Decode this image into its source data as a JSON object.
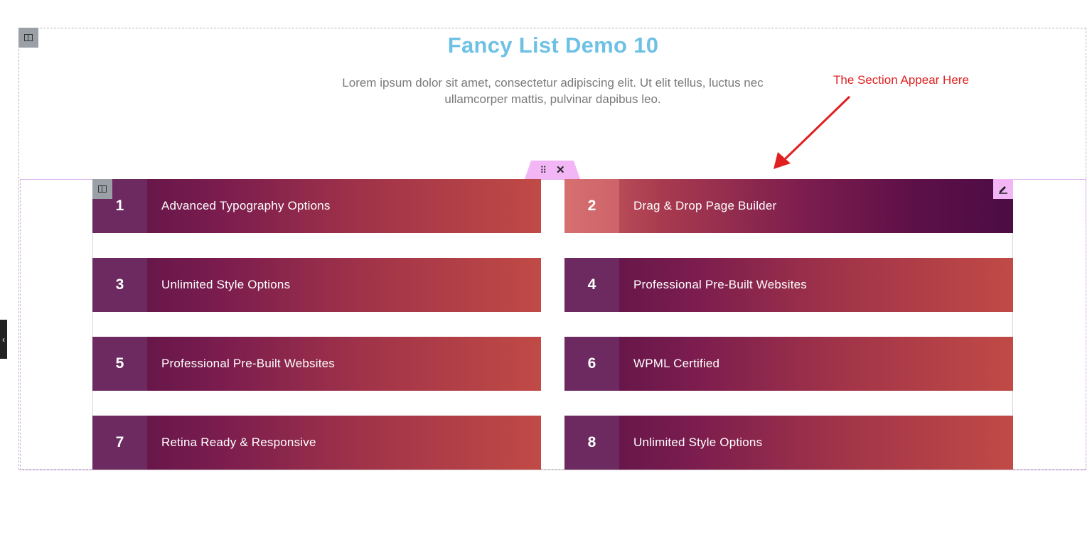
{
  "page": {
    "title": "Fancy List Demo 10",
    "description": "Lorem ipsum dolor sit amet, consectetur adipiscing elit. Ut elit tellus, luctus nec ullamcorper mattis, pulvinar dapibus leo."
  },
  "annotation": {
    "text": "The Section Appear Here",
    "color": "#e02020"
  },
  "editor": {
    "drag_icon": "⠿",
    "close_icon": "✕",
    "side_toggle": "‹"
  },
  "list": {
    "items": [
      {
        "number": "1",
        "label": "Advanced Typography Options"
      },
      {
        "number": "2",
        "label": "Drag & Drop Page Builder"
      },
      {
        "number": "3",
        "label": "Unlimited Style Options"
      },
      {
        "number": "4",
        "label": "Professional Pre-Built Websites"
      },
      {
        "number": "5",
        "label": "Professional Pre-Built Websites"
      },
      {
        "number": "6",
        "label": "WPML Certified"
      },
      {
        "number": "7",
        "label": "Retina Ready & Responsive"
      },
      {
        "number": "8",
        "label": "Unlimited Style Options"
      }
    ]
  },
  "colors": {
    "title": "#6ec1e4",
    "gradient_dark": "#5a1347",
    "gradient_light": "#c04a45",
    "editor_accent": "#f2b6f6"
  }
}
